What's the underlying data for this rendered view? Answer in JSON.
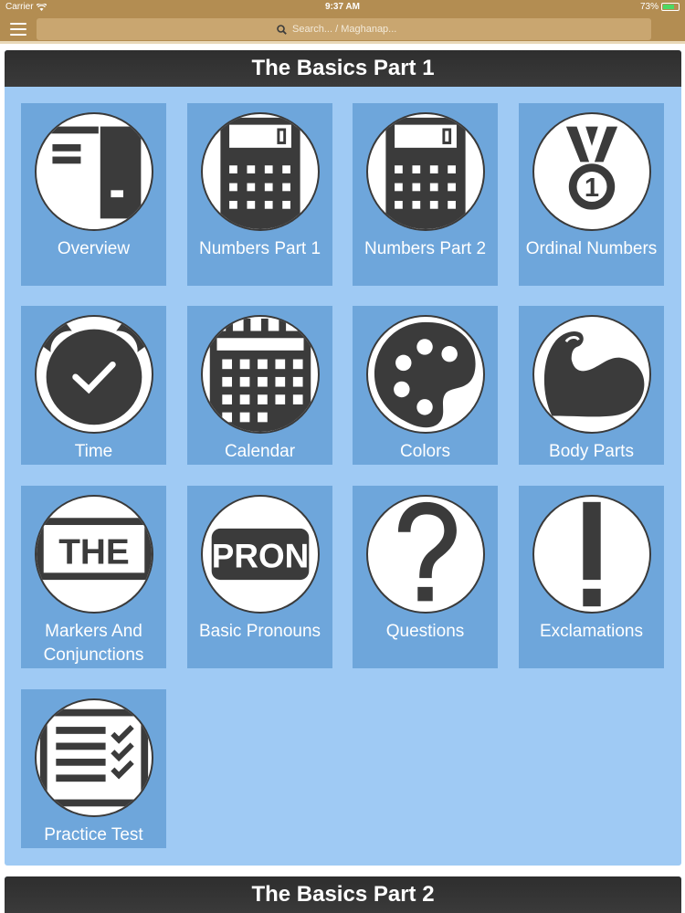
{
  "status_bar": {
    "carrier": "Carrier",
    "time": "9:37 AM",
    "battery": "73%",
    "battery_level": 0.73
  },
  "nav": {
    "search_placeholder": "Search... / Maghanap..."
  },
  "sections": [
    {
      "title": "The Basics Part 1",
      "tiles": [
        {
          "label": "Overview",
          "icon": "overview-icon"
        },
        {
          "label": "Numbers Part 1",
          "icon": "calculator-icon"
        },
        {
          "label": "Numbers Part 2",
          "icon": "calculator-icon"
        },
        {
          "label": "Ordinal Numbers",
          "icon": "medal-icon",
          "icon_text": "1"
        },
        {
          "label": "Time",
          "icon": "alarm-clock-icon"
        },
        {
          "label": "Calendar",
          "icon": "calendar-icon"
        },
        {
          "label": "Colors",
          "icon": "palette-icon"
        },
        {
          "label": "Body Parts",
          "icon": "flexed-arm-icon"
        },
        {
          "label": "Markers And Conjunctions",
          "icon": "the-marker-icon",
          "icon_text": "THE"
        },
        {
          "label": "Basic Pronouns",
          "icon": "pronoun-icon",
          "icon_text": "PRON"
        },
        {
          "label": "Questions",
          "icon": "question-mark-icon"
        },
        {
          "label": "Exclamations",
          "icon": "exclamation-mark-icon"
        },
        {
          "label": "Practice Test",
          "icon": "checklist-icon"
        }
      ]
    },
    {
      "title": "The Basics Part 2"
    }
  ]
}
